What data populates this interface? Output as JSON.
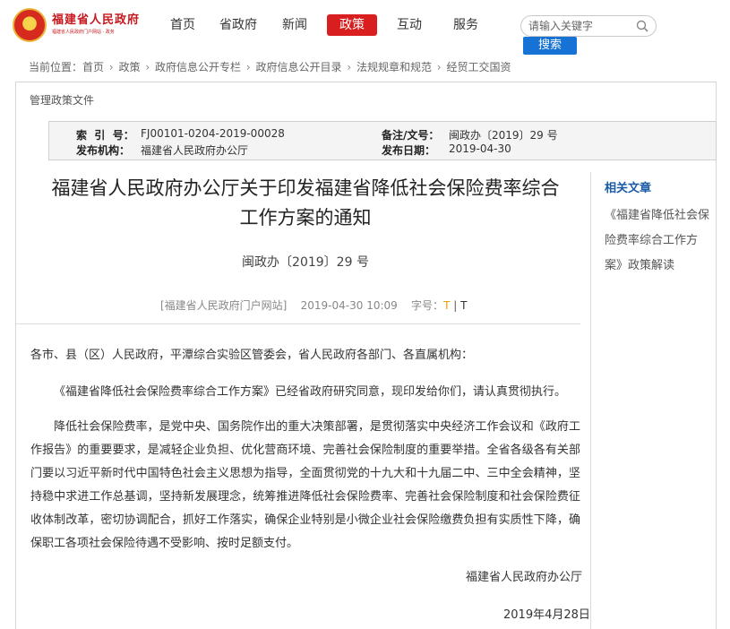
{
  "header": {
    "logo_title": "福建省人民政府",
    "logo_subtitle": "福建省人民政府门户网站 · 政务",
    "nav": [
      {
        "label": "首页",
        "active": false
      },
      {
        "label": "省政府",
        "active": false
      },
      {
        "label": "新闻",
        "active": false
      },
      {
        "label": "政策",
        "active": true
      },
      {
        "label": "互动",
        "active": false
      },
      {
        "label": "服务",
        "active": false
      }
    ],
    "search_placeholder": "请输入关键字",
    "search_button": "搜索"
  },
  "breadcrumb": {
    "prefix": "当前位置：",
    "items": [
      "首页",
      "政策",
      "政府信息公开专栏",
      "政府信息公开目录",
      "法规规章和规范",
      "经贸工交国资"
    ],
    "separator": "›"
  },
  "panel": {
    "title": "管理政策文件",
    "meta": {
      "index_label": "索  引  号：",
      "index_value": "FJ00101-0204-2019-00028",
      "remark_label": "备注/文号：",
      "remark_value": "闽政办〔2019〕29 号",
      "publisher_label": "发布机构：",
      "publisher_value": "福建省人民政府办公厅",
      "date_label": "发布日期：",
      "date_value": "2019-04-30"
    },
    "doc": {
      "title_line1": "福建省人民政府办公厅关于印发福建省降低社会保险费率综合",
      "title_line2": "工作方案的通知",
      "number": "闽政办〔2019〕29 号",
      "source": "[福建省人民政府门户网站]",
      "time": "2019-04-30 10:09",
      "font_label": "字号：",
      "font_large": "T",
      "font_sep": "|",
      "font_small": "T",
      "para1": "各市、县（区）人民政府，平潭综合实验区管委会，省人民政府各部门、各直属机构：",
      "para2": "《福建省降低社会保险费率综合工作方案》已经省政府研究同意，现印发给你们，请认真贯彻执行。",
      "para3": "降低社会保险费率，是党中央、国务院作出的重大决策部署，是贯彻落实中央经济工作会议和《政府工作报告》的重要要求，是减轻企业负担、优化营商环境、完善社会保险制度的重要举措。全省各级各有关部门要以习近平新时代中国特色社会主义思想为指导，全面贯彻党的十九大和十九届二中、三中全会精神，坚持稳中求进工作总基调，坚持新发展理念，统筹推进降低社会保险费率、完善社会保险制度和社会保险费征收体制改革，密切协调配合，抓好工作落实，确保企业特别是小微企业社会保险缴费负担有实质性下降，确保职工各项社会保险待遇不受影响、按时足额支付。",
      "signatory": "福建省人民政府办公厅",
      "sign_date": "2019年4月28日"
    },
    "related": {
      "title": "相关文章",
      "link": "《福建省降低社会保险费率综合工作方案》政策解读"
    }
  }
}
